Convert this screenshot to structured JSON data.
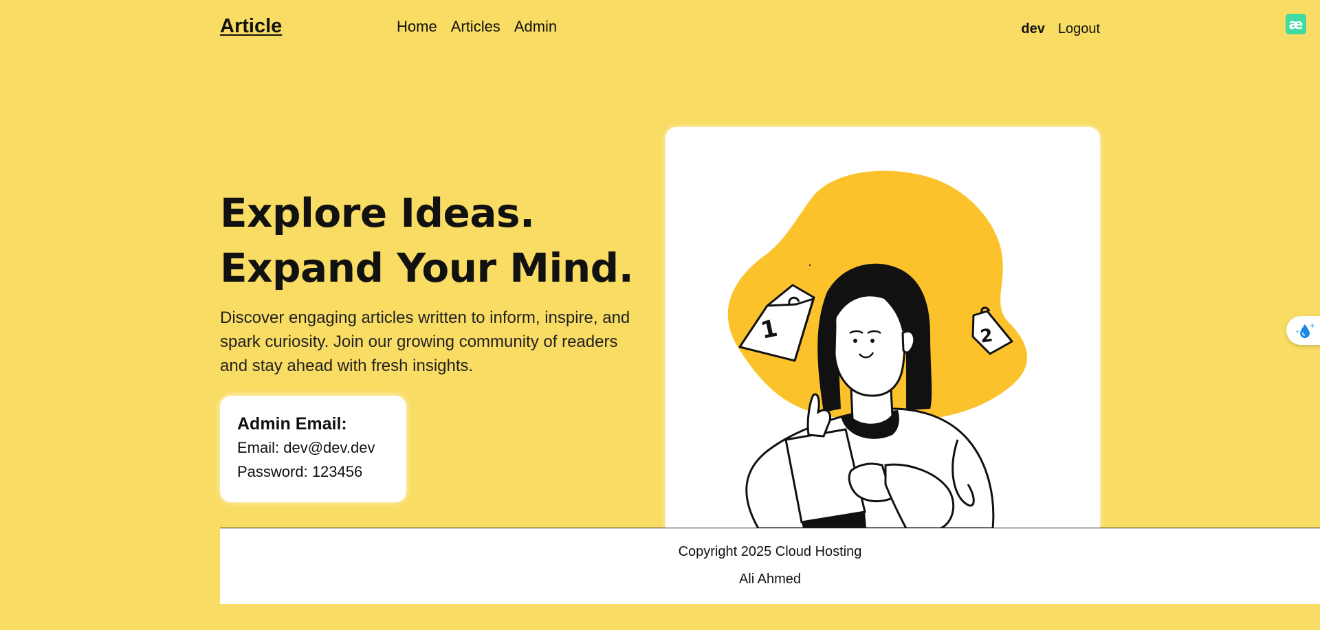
{
  "header": {
    "brand": "Article",
    "nav": [
      {
        "label": "Home"
      },
      {
        "label": "Articles"
      },
      {
        "label": "Admin"
      }
    ],
    "username": "dev",
    "logout_label": "Logout",
    "extension_badge": "æ"
  },
  "hero": {
    "title_line1": "Explore Ideas.",
    "title_line2": "Expand Your Mind.",
    "description": "Discover engaging articles written to inform, inspire, and spark curiosity. Join our growing community of readers and stay ahead with fresh insights.",
    "admin_card": {
      "title": "Admin Email:",
      "email_line": "Email: dev@dev.dev",
      "password_line": "Password: 123456"
    },
    "illustration": {
      "calendar_left": "1",
      "calendar_right": "2"
    }
  },
  "footer": {
    "copyright": "Copyright 2025 Cloud Hosting",
    "author": "Ali Ahmed"
  },
  "icons": {
    "side_tab": "water-drop-sparkle-icon",
    "extension": "extension-badge-icon"
  },
  "colors": {
    "background": "#f9dc63",
    "blob": "#fbc22c",
    "card": "#ffffff",
    "extension_badge": "#3fdba0",
    "drop": "#1e88e5"
  }
}
